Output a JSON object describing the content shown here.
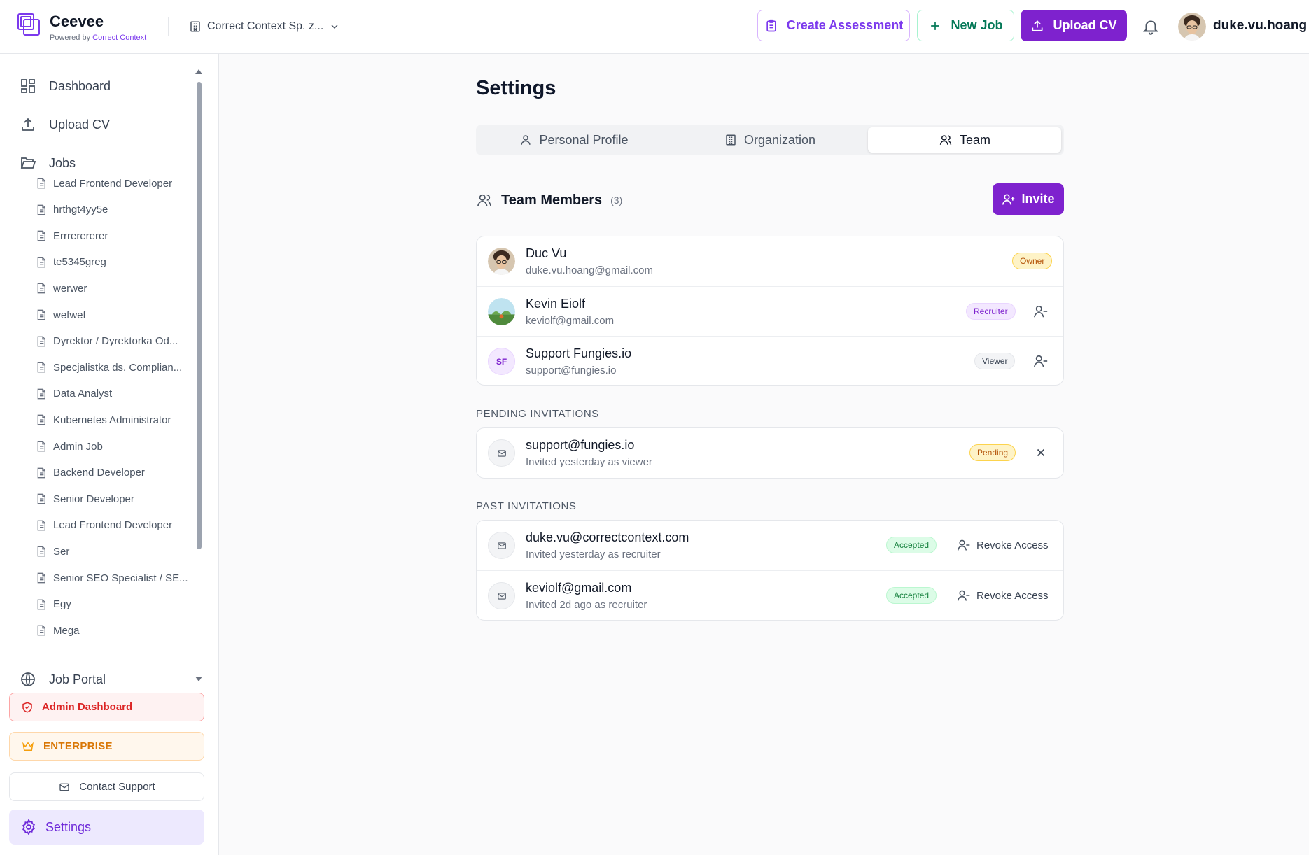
{
  "header": {
    "brand_name": "Ceevee",
    "brand_sub_prefix": "Powered by",
    "brand_sub_link": "Correct Context",
    "org_name": "Correct Context Sp. z...",
    "create_assessment": "Create Assessment",
    "new_job": "New Job",
    "upload_cv": "Upload CV",
    "username": "duke.vu.hoang"
  },
  "sidebar": {
    "nav": {
      "dashboard": "Dashboard",
      "upload_cv": "Upload CV",
      "jobs": "Jobs",
      "job_portal": "Job Portal"
    },
    "jobs": [
      "Lead Frontend Developer",
      "hrthgt4yy5e",
      "Errrerererer",
      "te5345greg",
      "werwer",
      "wefwef",
      "Dyrektor / Dyrektorka Od...",
      "Specjalistka ds. Complian...",
      "Data Analyst",
      "Kubernetes Administrator",
      "Admin Job",
      "Backend Developer",
      "Senior Developer",
      "Lead Frontend Developer",
      "Ser",
      "Senior SEO Specialist / SE...",
      "Egy",
      "Mega"
    ],
    "admin_dashboard": "Admin Dashboard",
    "enterprise": "ENTERPRISE",
    "contact_support": "Contact Support",
    "settings": "Settings"
  },
  "main": {
    "title": "Settings",
    "tabs": {
      "personal": "Personal Profile",
      "organization": "Organization",
      "team": "Team"
    },
    "team_members": {
      "title": "Team Members",
      "count": "(3)",
      "invite": "Invite",
      "members": [
        {
          "name": "Duc Vu",
          "email": "duke.vu.hoang@gmail.com",
          "role": "Owner"
        },
        {
          "name": "Kevin Eiolf",
          "email": "keviolf@gmail.com",
          "role": "Recruiter"
        },
        {
          "name": "Support Fungies.io",
          "email": "support@fungies.io",
          "role": "Viewer",
          "initials": "SF"
        }
      ]
    },
    "pending": {
      "title": "PENDING INVITATIONS",
      "items": [
        {
          "email": "support@fungies.io",
          "detail": "Invited yesterday as viewer",
          "status": "Pending"
        }
      ]
    },
    "past": {
      "title": "PAST INVITATIONS",
      "revoke_label": "Revoke Access",
      "items": [
        {
          "email": "duke.vu@correctcontext.com",
          "detail": "Invited yesterday as recruiter",
          "status": "Accepted"
        },
        {
          "email": "keviolf@gmail.com",
          "detail": "Invited 2d ago as recruiter",
          "status": "Accepted"
        }
      ]
    }
  },
  "colors": {
    "brand_purple": "#7e22ce",
    "accent_violet": "#7c3aed",
    "admin_red": "#dc2626",
    "enterprise_amber": "#d97706",
    "success_green": "#15803d"
  }
}
